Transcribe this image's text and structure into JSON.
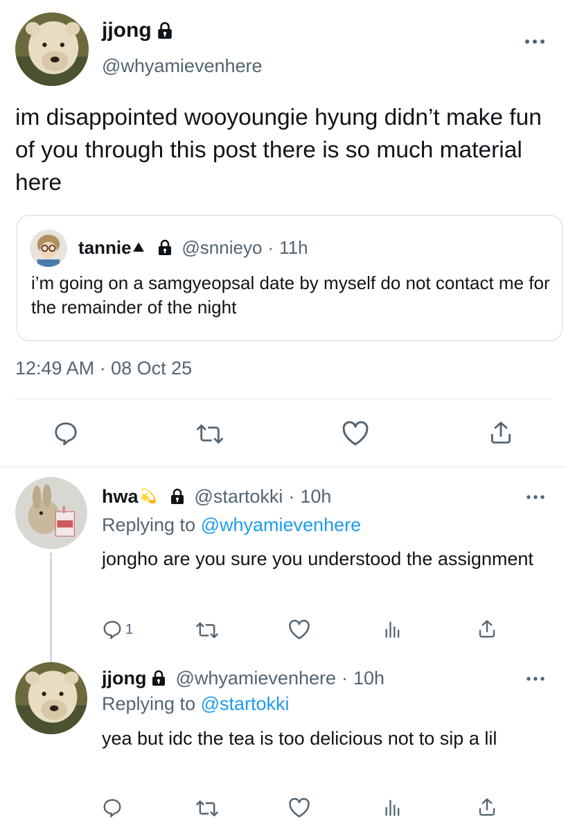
{
  "main_tweet": {
    "display_name": "jjong",
    "handle": "@whyamievenhere",
    "more_icon": "more-horizontal-icon",
    "text": "im disappointed wooyoungie hyung didn’t make fun of you through this post there is so much material here",
    "quote": {
      "display_name": "tannie",
      "name_emoji": "⛰",
      "handle": "@snnieyo",
      "separator": "·",
      "time": "11h",
      "text": "i’m going on a samgyeopsal date by myself do not contact me for the remainder of the night"
    },
    "timestamp": "12:49 AM · 08 Oct 25",
    "actions": [
      "reply-icon",
      "retweet-icon",
      "like-icon",
      "share-icon"
    ]
  },
  "replies": [
    {
      "display_name": "hwa",
      "name_emoji": "💫",
      "handle": "@startokki",
      "separator": "·",
      "time": "10h",
      "replying_prefix": "Replying to ",
      "replying_to": "@whyamievenhere",
      "text": "jongho are you sure you understood the assignment",
      "reply_count": "1",
      "actions": [
        "reply-icon",
        "retweet-icon",
        "like-icon",
        "analytics-icon",
        "share-icon"
      ]
    },
    {
      "display_name": "jjong",
      "handle": "@whyamievenhere",
      "separator": "·",
      "time": "10h",
      "replying_prefix": "Replying to ",
      "replying_to": "@startokki",
      "text": "yea but idc the tea is too delicious not to sip a lil",
      "actions": [
        "reply-icon",
        "retweet-icon",
        "like-icon",
        "analytics-icon",
        "share-icon"
      ]
    }
  ],
  "colors": {
    "text": "#0f1419",
    "muted": "#536471",
    "link": "#1d9bf0",
    "border": "#cfd9de"
  }
}
